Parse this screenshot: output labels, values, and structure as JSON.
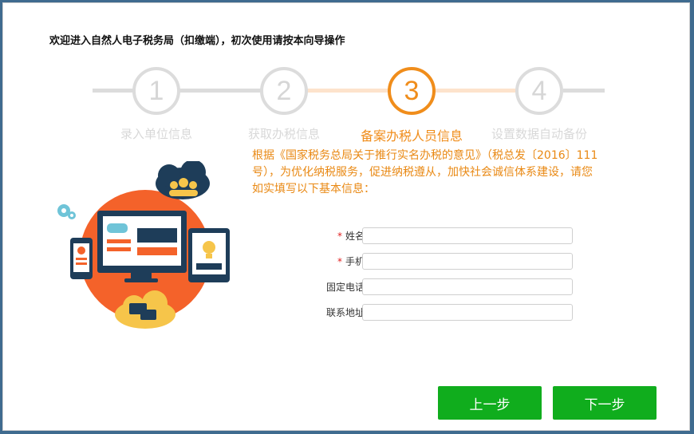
{
  "window": {
    "title": "欢迎进入自然人电子税务局（扣缴端），初次使用请按本向导操作"
  },
  "stepper": {
    "steps": [
      {
        "number": "1",
        "label": "录入单位信息",
        "state": "inactive"
      },
      {
        "number": "2",
        "label": "获取办税信息",
        "state": "inactive"
      },
      {
        "number": "3",
        "label": "备案办税人员信息",
        "state": "active"
      },
      {
        "number": "4",
        "label": "设置数据自动备份",
        "state": "inactive"
      }
    ]
  },
  "notice": {
    "text": "根据《国家税务总局关于推行实名办税的意见》（税总发〔2016〕111号），为优化纳税服务，促进纳税遵从，加快社会诚信体系建设，请您如实填写以下基本信息："
  },
  "form": {
    "fields": [
      {
        "label": "姓名：",
        "required": true,
        "value": "",
        "placeholder": ""
      },
      {
        "label": "手机：",
        "required": true,
        "value": "",
        "placeholder": ""
      },
      {
        "label": "固定电话：",
        "required": false,
        "value": "",
        "placeholder": ""
      },
      {
        "label": "联系地址：",
        "required": false,
        "value": "",
        "placeholder": ""
      }
    ],
    "required_marker": "*"
  },
  "buttons": {
    "prev_label": "上一步",
    "next_label": "下一步"
  },
  "colors": {
    "accent": "#f08d1b",
    "button": "#10ad1d",
    "inactive": "#dcdcdc",
    "required": "#e02020"
  }
}
